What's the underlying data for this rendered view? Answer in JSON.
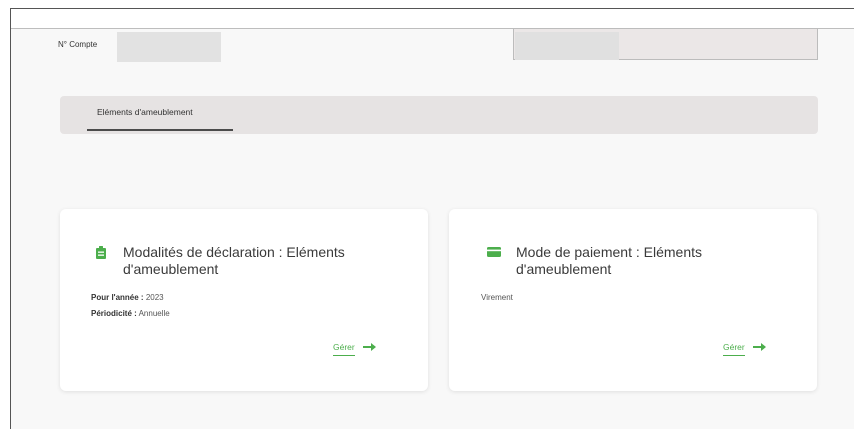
{
  "account": {
    "label": "N° Compte"
  },
  "tabs": [
    {
      "label": "Eléments d'ameublement"
    }
  ],
  "colors": {
    "accent": "#4cae4c"
  },
  "cards": [
    {
      "icon": "clipboard-icon",
      "title": "Modalités de déclaration : Eléments d'ameublement",
      "year_label": "Pour l'année :",
      "year_value": "2023",
      "period_label": "Périodicité :",
      "period_value": "Annuelle",
      "action_label": "Gérer"
    },
    {
      "icon": "credit-card-icon",
      "title": "Mode de paiement : Eléments d'ameublement",
      "value": "Virement",
      "action_label": "Gérer"
    }
  ]
}
